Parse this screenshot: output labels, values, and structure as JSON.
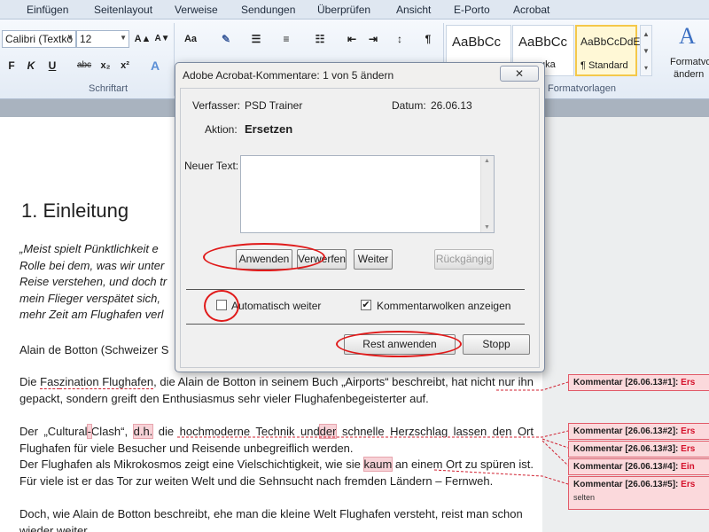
{
  "ribbon": {
    "tabs": [
      "Einfügen",
      "Seitenlayout",
      "Verweise",
      "Sendungen",
      "Überprüfen",
      "Ansicht",
      "E-Porto",
      "Acrobat"
    ],
    "font_name": "Calibri (Textkö",
    "font_size": "12",
    "group_font": "Schriftart",
    "group_styles": "Formatvorlagen",
    "styles": [
      {
        "sample": "AaBbCc",
        "name": ""
      },
      {
        "sample": "AaBbCc",
        "name": "uka"
      },
      {
        "sample": "AaBbCcDdE",
        "name": "¶ Standard"
      }
    ],
    "change_styles_line1": "Formatvorla",
    "change_styles_line2": "ändern",
    "buttons": {
      "bold": "F",
      "italic": "K",
      "underline": "U",
      "strike": "abc",
      "sub": "x₂",
      "sup": "x²",
      "pilcrow": "¶",
      "case": "Aa",
      "grow": "A▲",
      "shrink": "A▼"
    }
  },
  "document": {
    "heading": "1. Einleitung",
    "quote_lines": [
      "„Meist spielt Pünktlichkeit e",
      "Rolle bei dem, was wir unter",
      "Reise verstehen, und doch tr",
      "mein Flieger verspätet sich,",
      "mehr Zeit am Flughafen verl"
    ],
    "author_line": "Alain de Botton (Schweizer S",
    "para1": {
      "pre": "Die ",
      "mark1": "Fas",
      "mid": "zination Flughafen",
      "post": ", die Alain de Botton in seinem Buch „Airports“ beschreibt, hat nicht nur ihn gepackt, sondern greift den Enthusiasmus sehr vieler Flughafenbegeisterter auf."
    },
    "para2": {
      "pre": "Der „Cultural",
      "mark1": "-",
      "mid1": "Clash“, ",
      "mark2": "d.h.",
      "mid2": " die hochmoderne Technik und",
      "mark3": "der",
      "post": " schnelle Herzschlag lassen den Ort Flughafen für viele Besucher und Reisende unbegreiflich werden."
    },
    "para3": {
      "pre": "Der Flughafen als Mikrokosmos zeigt eine Vielschichtigkeit, wie sie ",
      "mark1": "kaum",
      "post": " an einem Ort zu spüren ist. Für viele ist er das Tor zur weiten Welt und die Sehnsucht nach fremden Ländern – Fernweh."
    },
    "para4": "Doch, wie Alain de Botton beschreibt, ehe man die kleine Welt Flughafen versteht, reist man schon wieder weiter."
  },
  "comments": [
    {
      "label": "Kommentar [26.06.13#1]:",
      "type": "Ers",
      "extra": ""
    },
    {
      "label": "Kommentar [26.06.13#2]:",
      "type": "Ers",
      "extra": ""
    },
    {
      "label": "Kommentar [26.06.13#3]:",
      "type": "Ers",
      "extra": ""
    },
    {
      "label": "Kommentar [26.06.13#4]:",
      "type": "Ein",
      "extra": ""
    },
    {
      "label": "Kommentar [26.06.13#5]:",
      "type": "Ers",
      "extra": "selten"
    }
  ],
  "dialog": {
    "title": "Adobe Acrobat-Kommentare: 1 von 5 ändern",
    "close_label": "✕",
    "author_label": "Verfasser:",
    "author_value": "PSD Trainer",
    "date_label": "Datum:",
    "date_value": "26.06.13",
    "action_label": "Aktion:",
    "action_value": "Ersetzen",
    "new_text_label": "Neuer Text:",
    "new_text_value": "",
    "apply_label": "Anwenden",
    "discard_label": "Verwerfen",
    "next_label": "Weiter",
    "undo_label": "Rückgängig",
    "auto_next_label": "Automatisch weiter",
    "auto_next_checked": false,
    "show_bubbles_label": "Kommentarwolken anzeigen",
    "show_bubbles_checked": true,
    "apply_rest_label": "Rest anwenden",
    "stop_label": "Stopp"
  },
  "colors": {
    "accent": "#e01a1a",
    "comment_bg": "#fbd9dc",
    "comment_border": "#e15a68"
  }
}
